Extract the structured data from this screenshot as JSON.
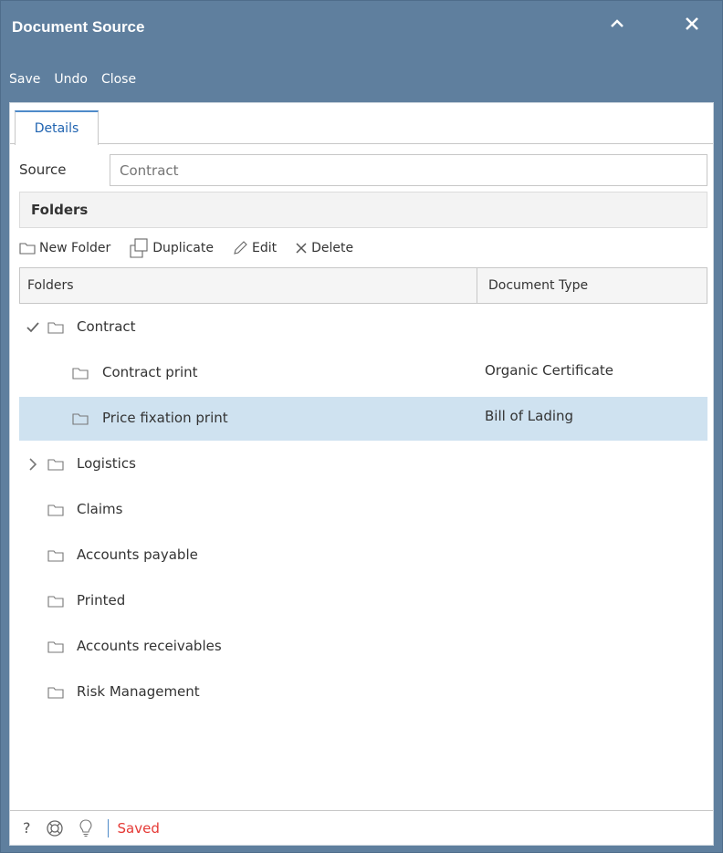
{
  "window": {
    "title": "Document Source",
    "icons": {
      "collapse": "chevron-up-icon",
      "close": "close-icon"
    }
  },
  "menu": {
    "save": "Save",
    "undo": "Undo",
    "close": "Close"
  },
  "tabs": [
    {
      "label": "Details",
      "active": true
    }
  ],
  "source": {
    "label": "Source",
    "placeholder": "Contract"
  },
  "folders_section": {
    "title": "Folders",
    "toolbar": {
      "new_folder": "New Folder",
      "duplicate": "Duplicate",
      "edit": "Edit",
      "delete": "Delete"
    },
    "columns": {
      "folders": "Folders",
      "document_type": "Document Type"
    },
    "rows": [
      {
        "label": "Contract",
        "document_type": "",
        "level": 0,
        "expander": "check-icon",
        "selected": false
      },
      {
        "label": "Contract print",
        "document_type": "Organic Certificate",
        "level": 1,
        "expander": "",
        "selected": false
      },
      {
        "label": "Price fixation print",
        "document_type": "Bill of Lading",
        "level": 1,
        "expander": "",
        "selected": true
      },
      {
        "label": "Logistics",
        "document_type": "",
        "level": 0,
        "expander": "chevron-right-icon",
        "selected": false
      },
      {
        "label": "Claims",
        "document_type": "",
        "level": 0,
        "expander": "",
        "selected": false
      },
      {
        "label": "Accounts payable",
        "document_type": "",
        "level": 0,
        "expander": "",
        "selected": false
      },
      {
        "label": "Printed",
        "document_type": "",
        "level": 0,
        "expander": "",
        "selected": false
      },
      {
        "label": "Accounts receivables",
        "document_type": "",
        "level": 0,
        "expander": "",
        "selected": false
      },
      {
        "label": "Risk Management",
        "document_type": "",
        "level": 0,
        "expander": "",
        "selected": false
      }
    ]
  },
  "status": {
    "help": "?",
    "text": "Saved",
    "text_color": "#e53935"
  },
  "colors": {
    "window_chrome": "#5f7f9e",
    "selected_row": "#cfe2f0",
    "tab_accent": "#4f8bc9"
  }
}
